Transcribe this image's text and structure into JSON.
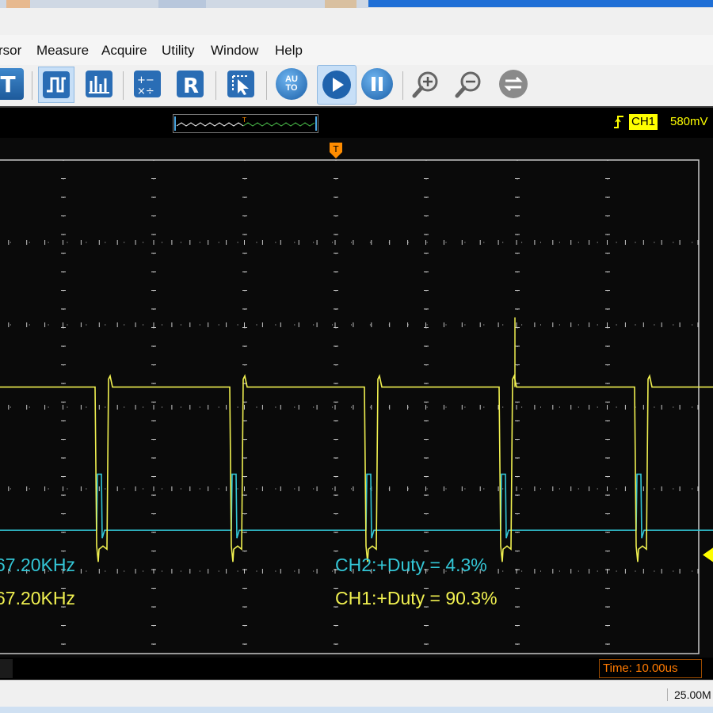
{
  "menu": [
    "rsor",
    "Measure",
    "Acquire",
    "Utility",
    "Window",
    "Help"
  ],
  "toolbar": {
    "buttons": [
      {
        "name": "trigger-t-button",
        "glyph": "T"
      },
      {
        "name": "pulse-button",
        "glyph": "⎍"
      },
      {
        "name": "hist-button",
        "glyph": "≡"
      },
      {
        "name": "math-button",
        "glyph": "×÷"
      },
      {
        "name": "ref-button",
        "glyph": "R"
      },
      {
        "name": "cursor-select-button",
        "glyph": "↖"
      },
      {
        "name": "auto-button",
        "glyph": "AUTO"
      },
      {
        "name": "run-button",
        "glyph": "▶"
      },
      {
        "name": "pause-button",
        "glyph": "❚❚"
      },
      {
        "name": "zoom-in-button",
        "glyph": "+"
      },
      {
        "name": "zoom-out-button",
        "glyph": "−"
      },
      {
        "name": "swap-button",
        "glyph": "⇆"
      }
    ]
  },
  "status": {
    "trigger_marker": "T",
    "channel": "CH1",
    "voltage": "580mV"
  },
  "measurements": {
    "ch2_freq": "67.20KHz",
    "ch1_freq": "67.20KHz",
    "ch2_duty": "CH2:+Duty = 4.3%",
    "ch1_duty": "CH1:+Duty = 90.3%"
  },
  "timebase": "Time: 10.00us",
  "sample_rate": "25.00M",
  "colors": {
    "ch1": "#f0f050",
    "ch2": "#33c6d6",
    "grid": "#c8c8c8",
    "trigger": "#ff8c00"
  },
  "trace": {
    "pulse_columns": [
      128,
      298,
      468,
      638,
      809
    ],
    "ch1_high_level": 0.46,
    "ch2_low_level": 0.75
  }
}
